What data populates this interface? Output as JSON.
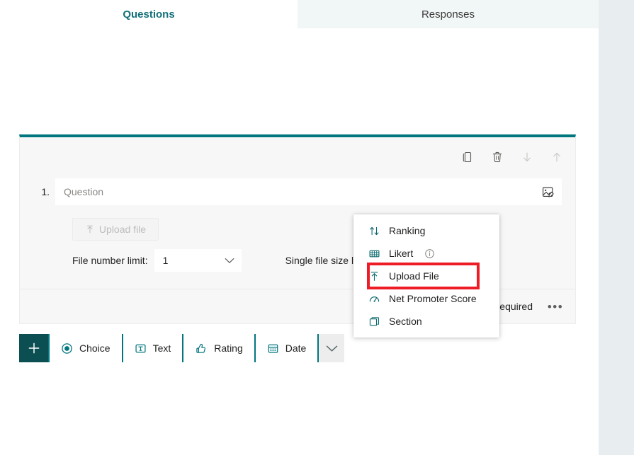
{
  "tabs": {
    "questions": "Questions",
    "responses": "Responses"
  },
  "card": {
    "question_number": "1.",
    "question_placeholder": "Question",
    "upload_button_label": "Upload file",
    "file_number_limit_label": "File number limit:",
    "file_number_limit_value": "1",
    "single_file_size_limit_label": "Single file size limit:",
    "required_label": "Required",
    "more_options_label": "•••",
    "toolbar": {
      "copy": "copy-question",
      "delete": "delete-question",
      "move_down": "move-question-down",
      "move_up": "move-question-up",
      "insert_media": "insert-media"
    }
  },
  "addbar": {
    "add_label": "+",
    "types": [
      {
        "label": "Choice",
        "icon": "radio-icon"
      },
      {
        "label": "Text",
        "icon": "text-box-icon"
      },
      {
        "label": "Rating",
        "icon": "thumbs-up-icon"
      },
      {
        "label": "Date",
        "icon": "calendar-icon"
      }
    ],
    "more_label": "chevron-down-icon"
  },
  "menu": {
    "items": [
      {
        "label": "Ranking",
        "icon": "ranking-arrows-icon",
        "info": false
      },
      {
        "label": "Likert",
        "icon": "likert-grid-icon",
        "info": true
      },
      {
        "label": "Upload File",
        "icon": "upload-arrow-icon",
        "info": false
      },
      {
        "label": "Net Promoter Score",
        "icon": "gauge-icon",
        "info": false
      },
      {
        "label": "Section",
        "icon": "section-stack-icon",
        "info": false
      }
    ]
  },
  "colors": {
    "accent_teal": "#00767e",
    "accent_dark_teal": "#0b4f52",
    "tab_active_text": "#12707a",
    "highlight_red": "#ee1c25",
    "responses_tab_bg": "#f1f7f7",
    "right_rail_bg": "#e8eef0",
    "card_bg": "#f7f7f7"
  }
}
